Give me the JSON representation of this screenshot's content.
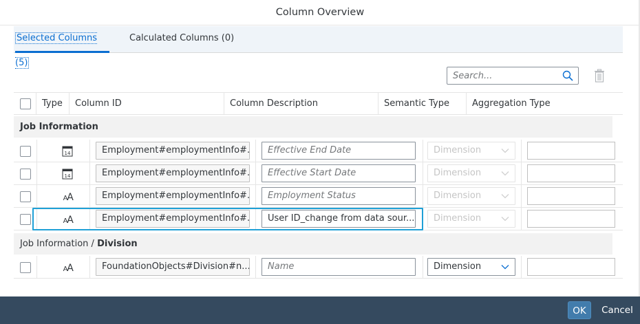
{
  "dialog": {
    "title": "Column Overview",
    "ok_label": "OK",
    "cancel_label": "Cancel"
  },
  "tabs": [
    {
      "label": "Selected Columns (5)",
      "selected": true
    },
    {
      "label": "Calculated Columns (0)",
      "selected": false
    }
  ],
  "search": {
    "placeholder": "Search...",
    "value": ""
  },
  "columns": {
    "type": "Type",
    "column_id": "Column ID",
    "column_description": "Column Description",
    "semantic_type": "Semantic Type",
    "aggregation_type": "Aggregation Type"
  },
  "groups": [
    {
      "prefix": "",
      "name": "Job Information",
      "rows": [
        {
          "type_icon": "calendar-icon",
          "column_id": "Employment#employmentInfo#...",
          "description": "",
          "description_placeholder": "Effective End Date",
          "semantic_type": "Dimension",
          "semantic_enabled": false,
          "aggregation": ""
        },
        {
          "type_icon": "calendar-icon",
          "column_id": "Employment#employmentInfo#...",
          "description": "",
          "description_placeholder": "Effective Start Date",
          "semantic_type": "Dimension",
          "semantic_enabled": false,
          "aggregation": ""
        },
        {
          "type_icon": "text-type-icon",
          "column_id": "Employment#employmentInfo#...",
          "description": "",
          "description_placeholder": "Employment Status",
          "semantic_type": "Dimension",
          "semantic_enabled": false,
          "aggregation": ""
        },
        {
          "type_icon": "text-type-icon",
          "column_id": "Employment#employmentInfo#...",
          "description": "User ID_change from data sour...",
          "description_placeholder": "",
          "semantic_type": "Dimension",
          "semantic_enabled": false,
          "aggregation": ""
        }
      ]
    },
    {
      "prefix": "Job Information / ",
      "name": "Division",
      "rows": [
        {
          "type_icon": "text-type-icon",
          "column_id": "FoundationObjects#Division#n...",
          "description": "",
          "description_placeholder": "Name",
          "semantic_type": "Dimension",
          "semantic_enabled": true,
          "aggregation": ""
        }
      ]
    }
  ],
  "colors": {
    "accent": "#0a6ed1",
    "highlight": "#1fa0d6",
    "footer": "#354a5f",
    "ok_button": "#427cac"
  }
}
